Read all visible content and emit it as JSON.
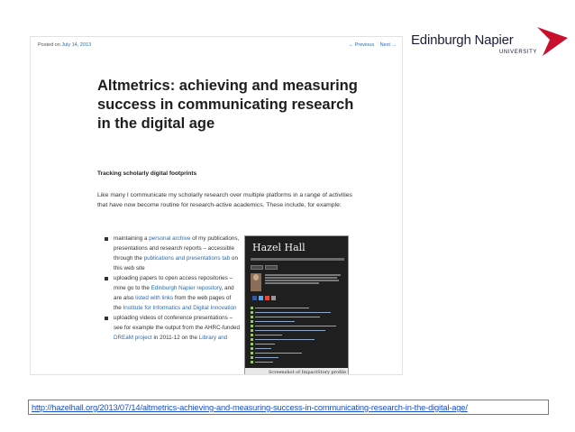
{
  "logo": {
    "name": "Edinburgh Napier",
    "sub": "UNIVERSITY",
    "color": "#c8102e"
  },
  "blog": {
    "posted_prefix": "Posted on",
    "posted_date": "July 14, 2013",
    "previous": "← Previous",
    "next": "Next →",
    "title": "Altmetrics: achieving and measuring success in communicating research in the digital age",
    "subtitle": "Tracking scholarly digital footprints",
    "intro": "Like many I communicate my scholarly research over multiple platforms in a range of activities that have now become routine for research-active academics. These include, for example:",
    "bullets": [
      {
        "a": "maintaining a ",
        "link1": "personal archive",
        "b": " of my publications, presentations and research reports – accessible through the ",
        "link2": "publications and presentations tab",
        "c": " on this web site"
      },
      {
        "a": "uploading papers to open access repositories – mine go to the ",
        "link1": "Edinburgh Napier repository",
        "b": ", and are also ",
        "link2": "listed with links",
        "c": " from the web pages of the ",
        "link3": "Institute for Informatics and Digital Innovation"
      },
      {
        "a": "uploading videos of conference presentations – see for example the output from the AHRC-funded ",
        "link1": "DREaM project",
        "b": " in 2011-12 on the ",
        "link2": "Library and"
      }
    ],
    "inner_screenshot": {
      "name": "Hazel Hall",
      "caption": "Screenshot of ImpactStory profile"
    }
  },
  "url": "http://hazelhall.org/2013/07/14/altmetrics-achieving-and-measuring-success-in-communicating-research-in-the-digital-age/"
}
